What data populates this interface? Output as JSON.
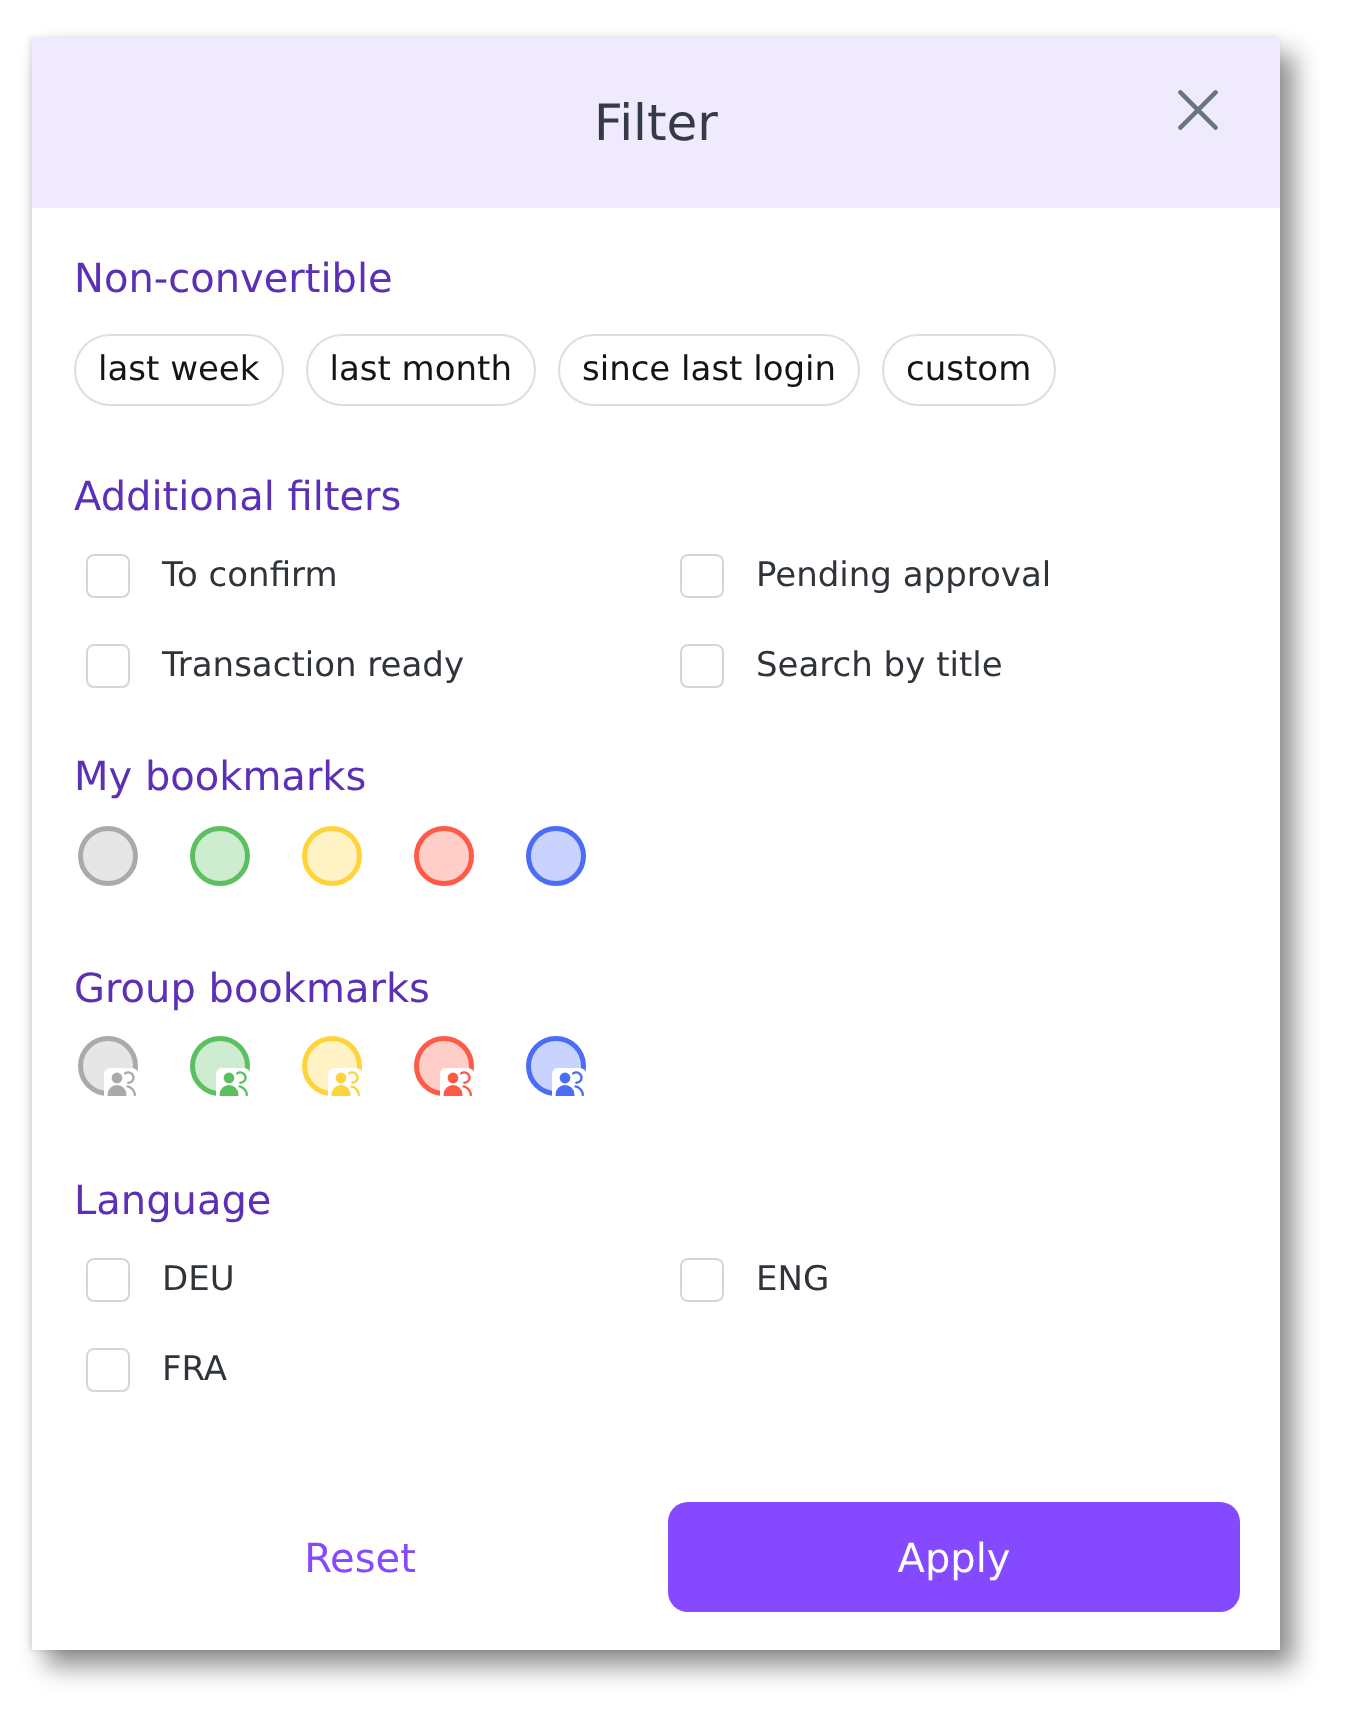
{
  "dialog": {
    "title": "Filter"
  },
  "sections": [
    {
      "kind": "chips",
      "heading": "Non-convertible",
      "chips": [
        {
          "label": "last week",
          "selected": false
        },
        {
          "label": "last month",
          "selected": false
        },
        {
          "label": "since last login",
          "selected": false
        },
        {
          "label": "custom",
          "selected": false
        }
      ]
    },
    {
      "kind": "checkboxes",
      "heading": "Additional filters",
      "options": [
        {
          "label": "To confirm",
          "checked": false
        },
        {
          "label": "Pending approval",
          "checked": false
        },
        {
          "label": "Transaction ready",
          "checked": false
        },
        {
          "label": "Search by title",
          "checked": false
        }
      ]
    },
    {
      "kind": "bookmarks",
      "heading": "My bookmarks",
      "swatches": [
        {
          "color": "#aaaaaa",
          "selected": false
        },
        {
          "color": "#5cc060",
          "selected": false
        },
        {
          "color": "#ffd43b",
          "selected": false
        },
        {
          "color": "#ff5a48",
          "selected": false
        },
        {
          "color": "#4a6cf7",
          "selected": false
        }
      ]
    },
    {
      "kind": "group_bookmarks",
      "heading": "Group bookmarks",
      "swatches": [
        {
          "color": "#aaaaaa",
          "selected": false
        },
        {
          "color": "#5cc060",
          "selected": false
        },
        {
          "color": "#ffd43b",
          "selected": false
        },
        {
          "color": "#ff5a48",
          "selected": false
        },
        {
          "color": "#4a6cf7",
          "selected": false
        }
      ]
    },
    {
      "kind": "checkboxes",
      "heading": "Language",
      "options": [
        {
          "label": "DEU",
          "checked": false
        },
        {
          "label": "ENG",
          "checked": false
        },
        {
          "label": "FRA",
          "checked": false
        }
      ]
    }
  ],
  "footer": {
    "reset": "Reset",
    "apply": "Apply"
  }
}
